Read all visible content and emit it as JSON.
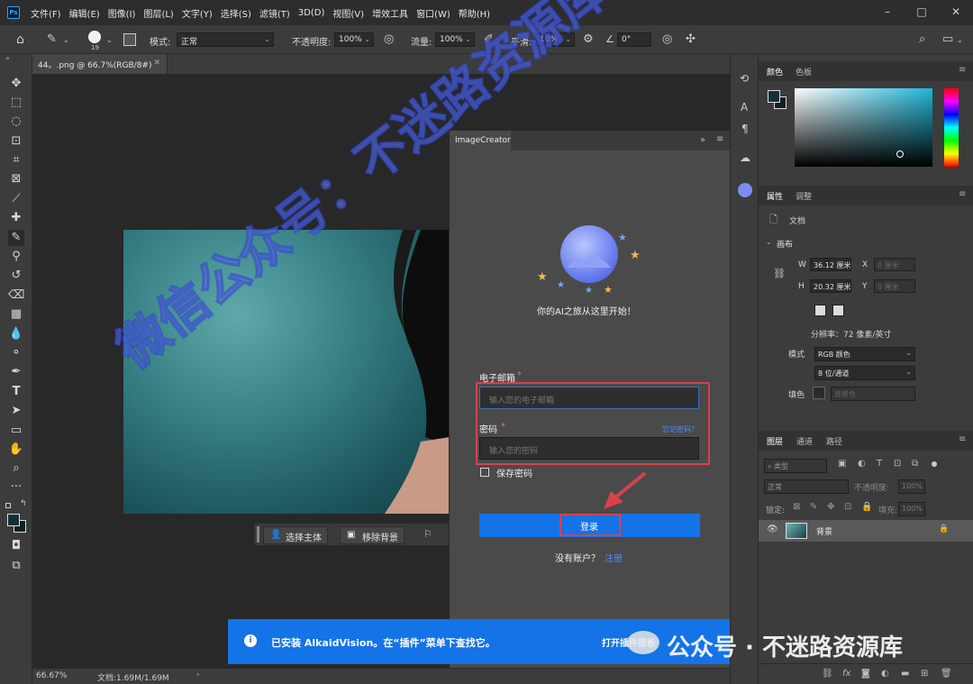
{
  "menu": {
    "logo": "Ps",
    "items": [
      "文件(F)",
      "编辑(E)",
      "图像(I)",
      "图层(L)",
      "文字(Y)",
      "选择(S)",
      "滤镜(T)",
      "3D(D)",
      "视图(V)",
      "增效工具",
      "窗口(W)",
      "帮助(H)"
    ]
  },
  "options": {
    "brush_size": "19",
    "mode_label": "模式:",
    "mode_value": "正常",
    "opacity_label": "不透明度:",
    "opacity_value": "100%",
    "flow_label": "流量:",
    "flow_value": "100%",
    "smooth_label": "平滑:",
    "smooth_value": "10%",
    "angle_value": "0°"
  },
  "document": {
    "tab_title": "44。.png @ 66.7%(RGB/8#)",
    "zoom": "66.67%",
    "doc_info": "文档:1.69M/1.69M"
  },
  "image_creator": {
    "tab": "ImageCreator",
    "tagline": "你的AI之旅从这里开始！",
    "email_label": "电子邮箱",
    "email_placeholder": "输入您的电子邮箱",
    "password_label": "密码",
    "forgot": "忘记密码？",
    "password_placeholder": "输入您的密码",
    "remember": "保存密码",
    "login": "登录",
    "no_account": "没有账户？",
    "register": "注册",
    "required_mark": "*"
  },
  "context_bar": {
    "select_subject": "选择主体",
    "remove_bg": "移除背景",
    "more": "···"
  },
  "notification": {
    "message": "已安装 AlkaidVision。在“插件”菜单下查找它。",
    "action": "打开",
    "action_tail": "插件面板"
  },
  "watermark": {
    "diagonal": "微信公众号：不迷路资源库",
    "bottom": "公众号 · 不迷路资源库"
  },
  "color_panel": {
    "tab_color": "颜色",
    "tab_swatches": "色板"
  },
  "properties": {
    "tab_properties": "属性",
    "tab_adjustments": "调整",
    "doc_label": "文档",
    "section": "画布",
    "w_label": "W",
    "w_value": "36.12 厘米",
    "x_label": "X",
    "x_value": "0 厘米",
    "h_label": "H",
    "h_value": "20.32 厘米",
    "y_label": "Y",
    "y_value": "0 厘米",
    "resolution": "分辨率：72 像素/英寸",
    "mode_label": "模式",
    "mode_value": "RGB 颜色",
    "depth_value": "8 位/通道",
    "fill_label": "填色",
    "fill_value": "背景色"
  },
  "layers": {
    "tab_layers": "图层",
    "tab_channels": "通道",
    "tab_paths": "路径",
    "filter_kind": "类型",
    "blend_mode": "正常",
    "opacity_label": "不透明度:",
    "opacity_value": "100%",
    "lock_label": "锁定:",
    "fill_label": "填充:",
    "fill_value": "100%",
    "layer_name": "背景"
  },
  "colors": {
    "accent_blue": "#1473e6",
    "red_highlight": "#d8414a",
    "link_blue": "#4d8fff"
  }
}
